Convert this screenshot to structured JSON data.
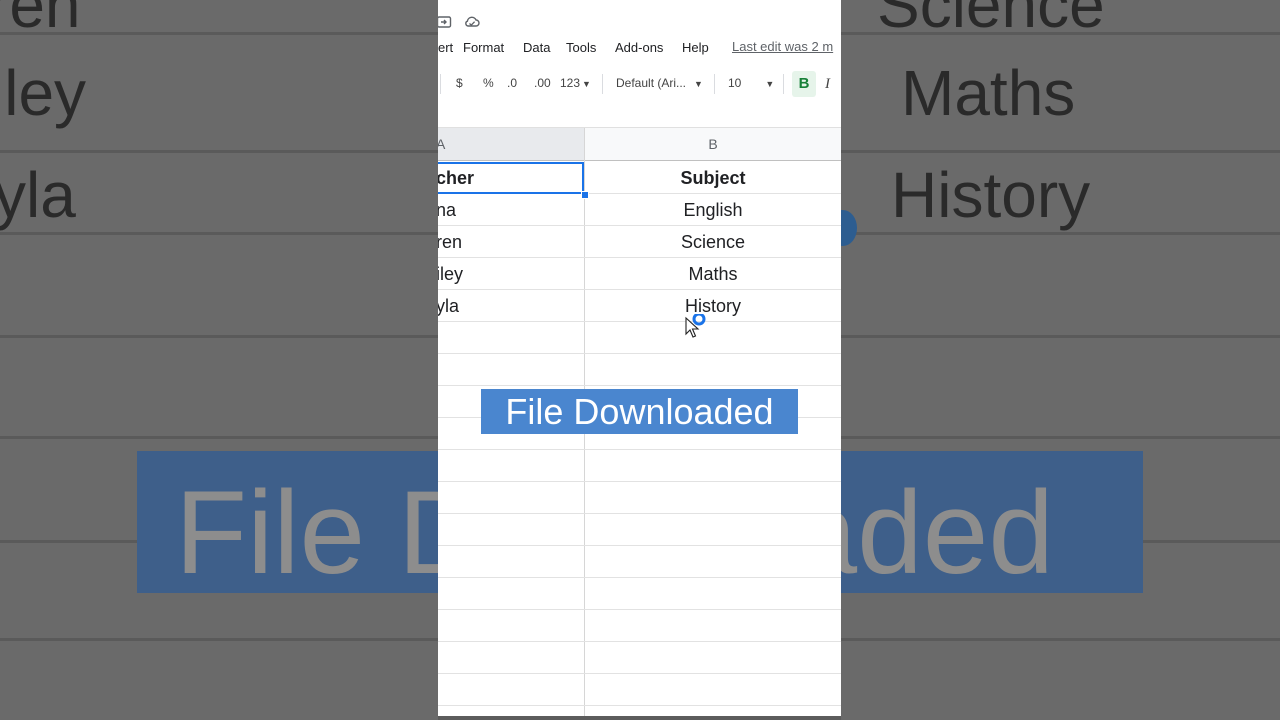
{
  "background": {
    "words_left": [
      "ren",
      "iley",
      "yla"
    ],
    "words_right": [
      "Science",
      "Maths",
      "History"
    ],
    "banner_text": "File Downloaded"
  },
  "menubar": {
    "items": [
      "ert",
      "Format",
      "Data",
      "Tools",
      "Add-ons",
      "Help"
    ],
    "last_edit": "Last edit was 2 m"
  },
  "toolbar": {
    "currency": "$",
    "percent": "%",
    "decrease_decimals": ".0",
    "increase_decimals": ".00",
    "more_formats": "123",
    "font": "Default (Ari...",
    "font_size": "10",
    "bold": "B",
    "italic": "I"
  },
  "columns": [
    "A",
    "B"
  ],
  "rows": [
    {
      "a": "cher",
      "b": "Subject"
    },
    {
      "a": "na",
      "b": "English"
    },
    {
      "a": "ren",
      "b": "Science"
    },
    {
      "a": "iley",
      "b": "Maths"
    },
    {
      "a": "yla",
      "b": "History"
    }
  ],
  "toast": "File Downloaded",
  "colors": {
    "accent": "#1a73e8",
    "toast_bg": "#4a86cf",
    "bold_active": "#188038"
  }
}
